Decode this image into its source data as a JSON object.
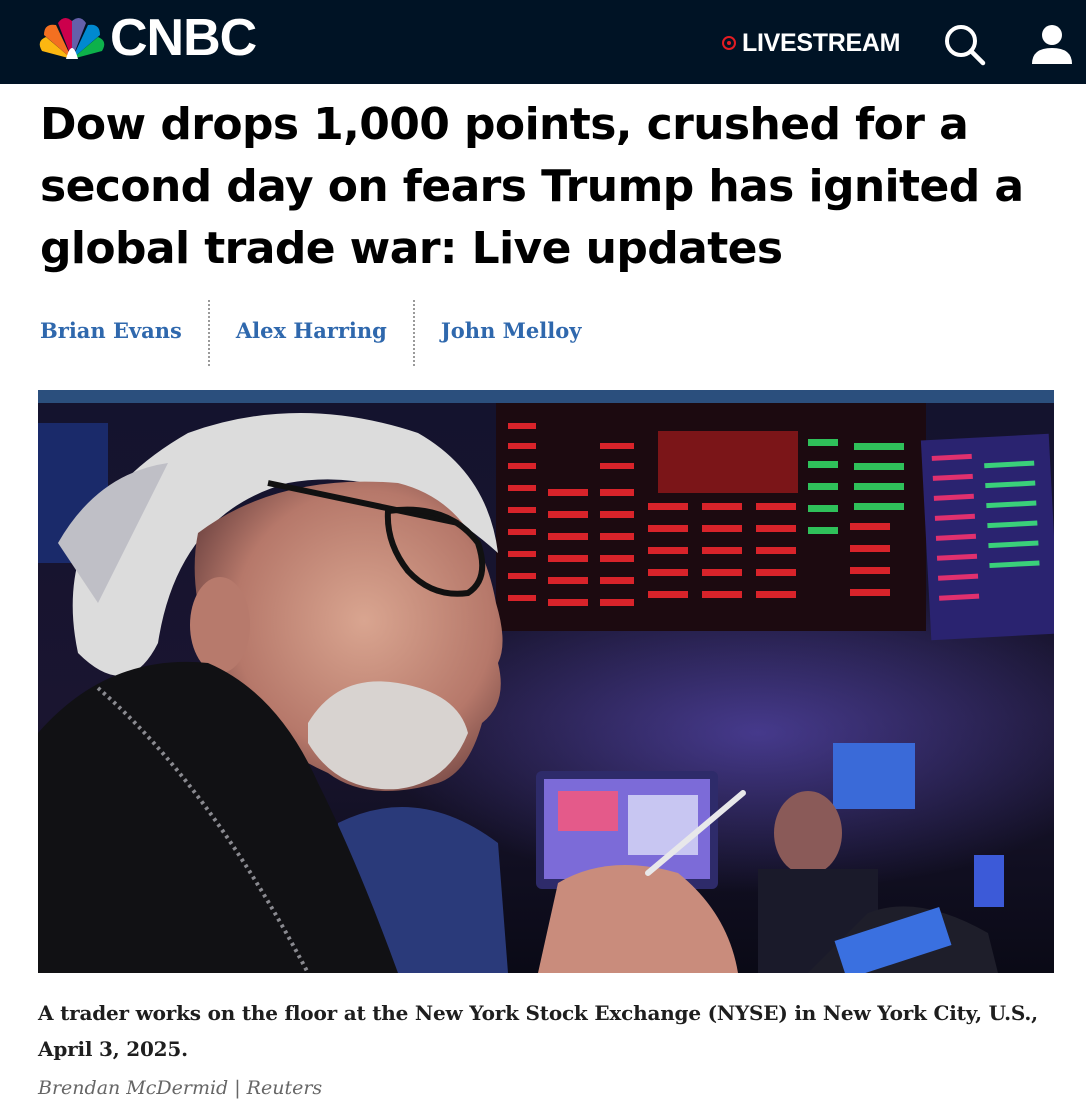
{
  "header": {
    "logo_text": "CNBC",
    "livestream_label": "LIVESTREAM",
    "background_color": "#001325",
    "live_color": "#e41c23",
    "icons": [
      "peacock-logo-icon",
      "live-dot-icon",
      "search-icon",
      "user-icon"
    ]
  },
  "article": {
    "headline": "Dow drops 1,000 points, crushed for a second day on fears Trump has ignited a global trade war: Live updates",
    "authors": [
      {
        "name": "Brian Evans"
      },
      {
        "name": "Alex Harring"
      },
      {
        "name": "John Melloy"
      }
    ],
    "author_link_color": "#2f68ad",
    "image": {
      "subject": "trader-on-nyse-floor-photo",
      "caption": "A trader works on the floor at the New York Stock Exchange (NYSE) in New York City, U.S., April 3, 2025.",
      "credit": "Brendan McDermid | Reuters"
    }
  }
}
